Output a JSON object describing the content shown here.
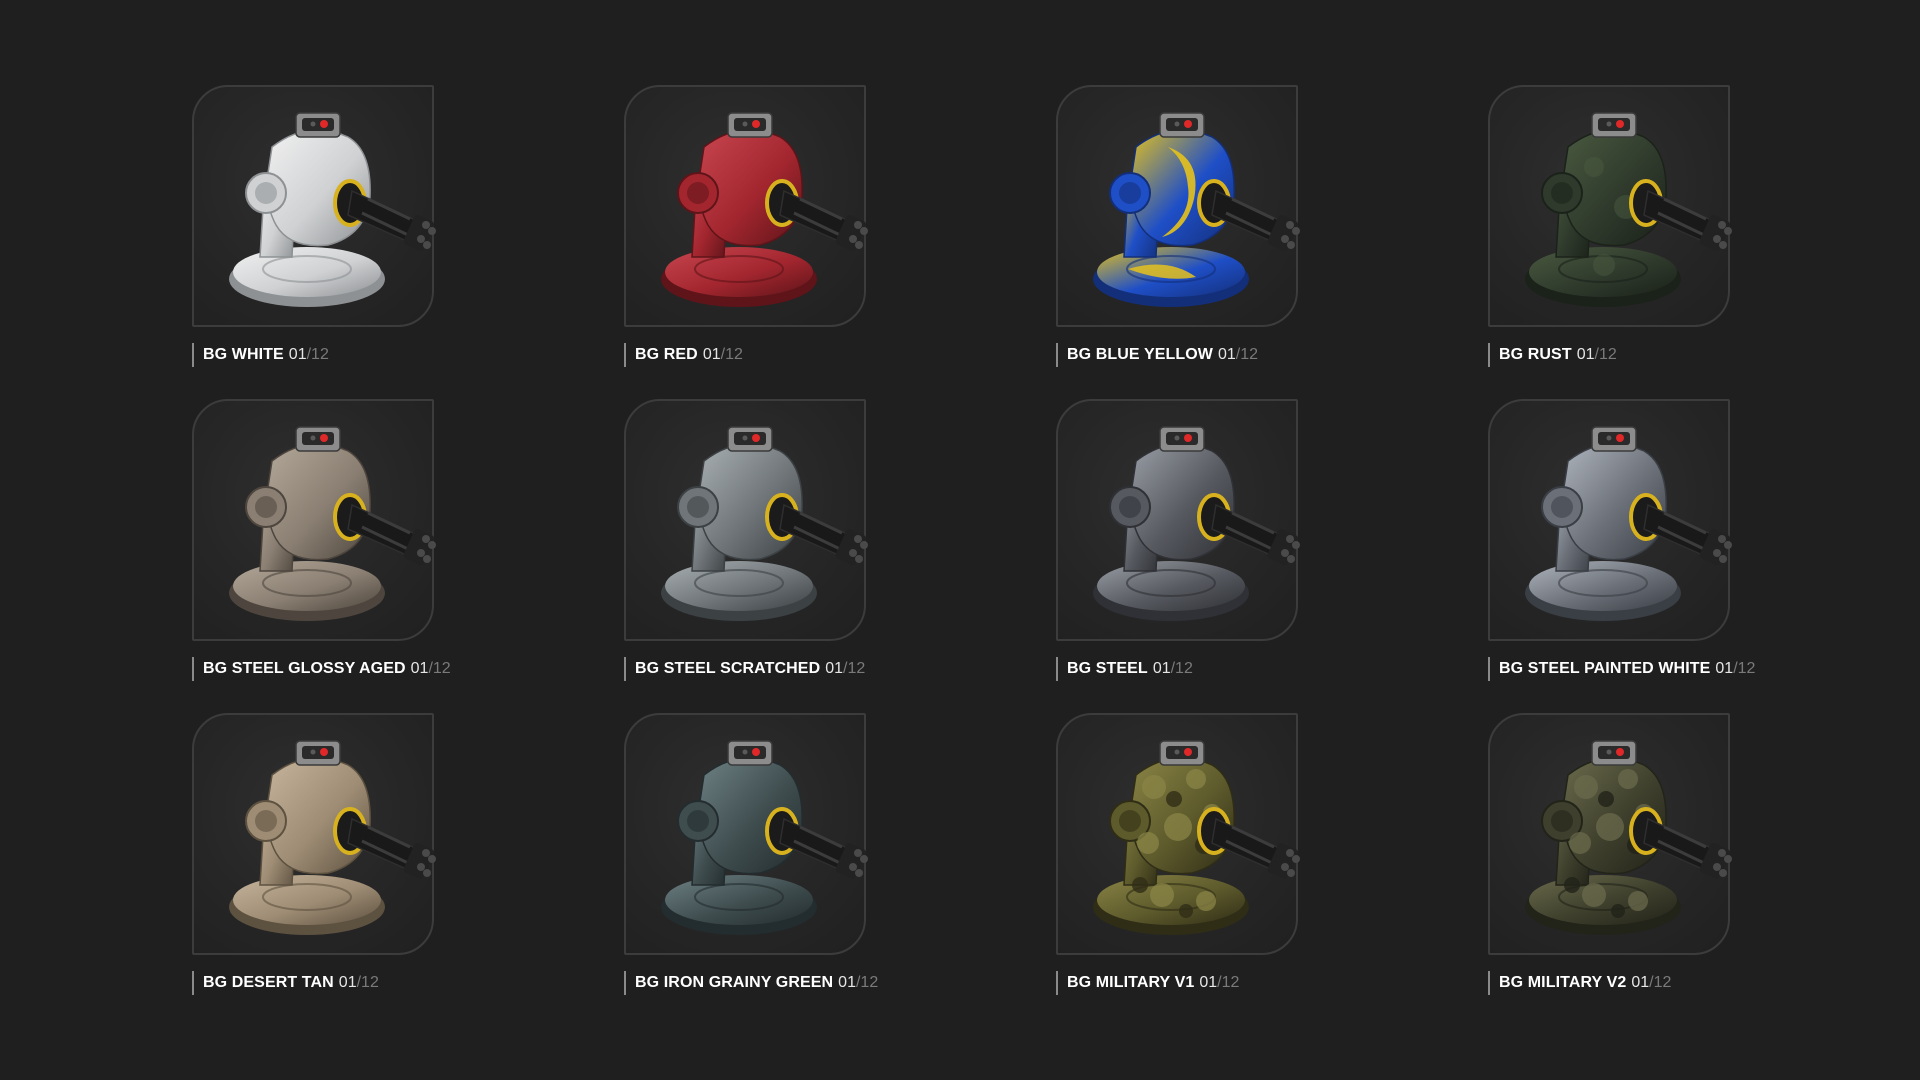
{
  "items": [
    {
      "name": "BG WHITE",
      "index": "01",
      "total": "/12",
      "body": "#cfd1d3",
      "shade": "#8e9193",
      "accent": "#f1f1f1",
      "pattern": "none"
    },
    {
      "name": "BG RED",
      "index": "01",
      "total": "/12",
      "body": "#a3262f",
      "shade": "#5e1419",
      "accent": "#c84650",
      "pattern": "none"
    },
    {
      "name": "BG BLUE YELLOW",
      "index": "01",
      "total": "/12",
      "body": "#1f4fc7",
      "shade": "#132f7a",
      "accent": "#e6c21c",
      "pattern": "stripes"
    },
    {
      "name": "BG RUST",
      "index": "01",
      "total": "/12",
      "body": "#2f3a2c",
      "shade": "#1b221a",
      "accent": "#4a5a40",
      "pattern": "blotch"
    },
    {
      "name": "BG STEEL GLOSSY AGED",
      "index": "01",
      "total": "/12",
      "body": "#8a7f72",
      "shade": "#4e463e",
      "accent": "#b3a899",
      "pattern": "none"
    },
    {
      "name": "BG STEEL SCRATCHED",
      "index": "01",
      "total": "/12",
      "body": "#6f7578",
      "shade": "#3c4144",
      "accent": "#a9b0b3",
      "pattern": "none"
    },
    {
      "name": "BG STEEL",
      "index": "01",
      "total": "/12",
      "body": "#56595f",
      "shade": "#2f3136",
      "accent": "#9a9ea6",
      "pattern": "none"
    },
    {
      "name": "BG STEEL PAINTED WHITE",
      "index": "01",
      "total": "/12",
      "body": "#6b7078",
      "shade": "#3a3e45",
      "accent": "#aeb4bd",
      "pattern": "none"
    },
    {
      "name": "BG DESERT TAN",
      "index": "01",
      "total": "/12",
      "body": "#9e8c74",
      "shade": "#5d5140",
      "accent": "#c6b59c",
      "pattern": "none"
    },
    {
      "name": "BG IRON GRAINY GREEN",
      "index": "01",
      "total": "/12",
      "body": "#3f4d4f",
      "shade": "#232c2e",
      "accent": "#6e8184",
      "pattern": "none"
    },
    {
      "name": "BG MILITARY V1",
      "index": "01",
      "total": "/12",
      "body": "#5d5a2c",
      "shade": "#2f2d16",
      "accent": "#8a8445",
      "pattern": "camo"
    },
    {
      "name": "BG MILITARY V2",
      "index": "01",
      "total": "/12",
      "body": "#3e3f2c",
      "shade": "#222319",
      "accent": "#6a6a4c",
      "pattern": "camo"
    }
  ]
}
